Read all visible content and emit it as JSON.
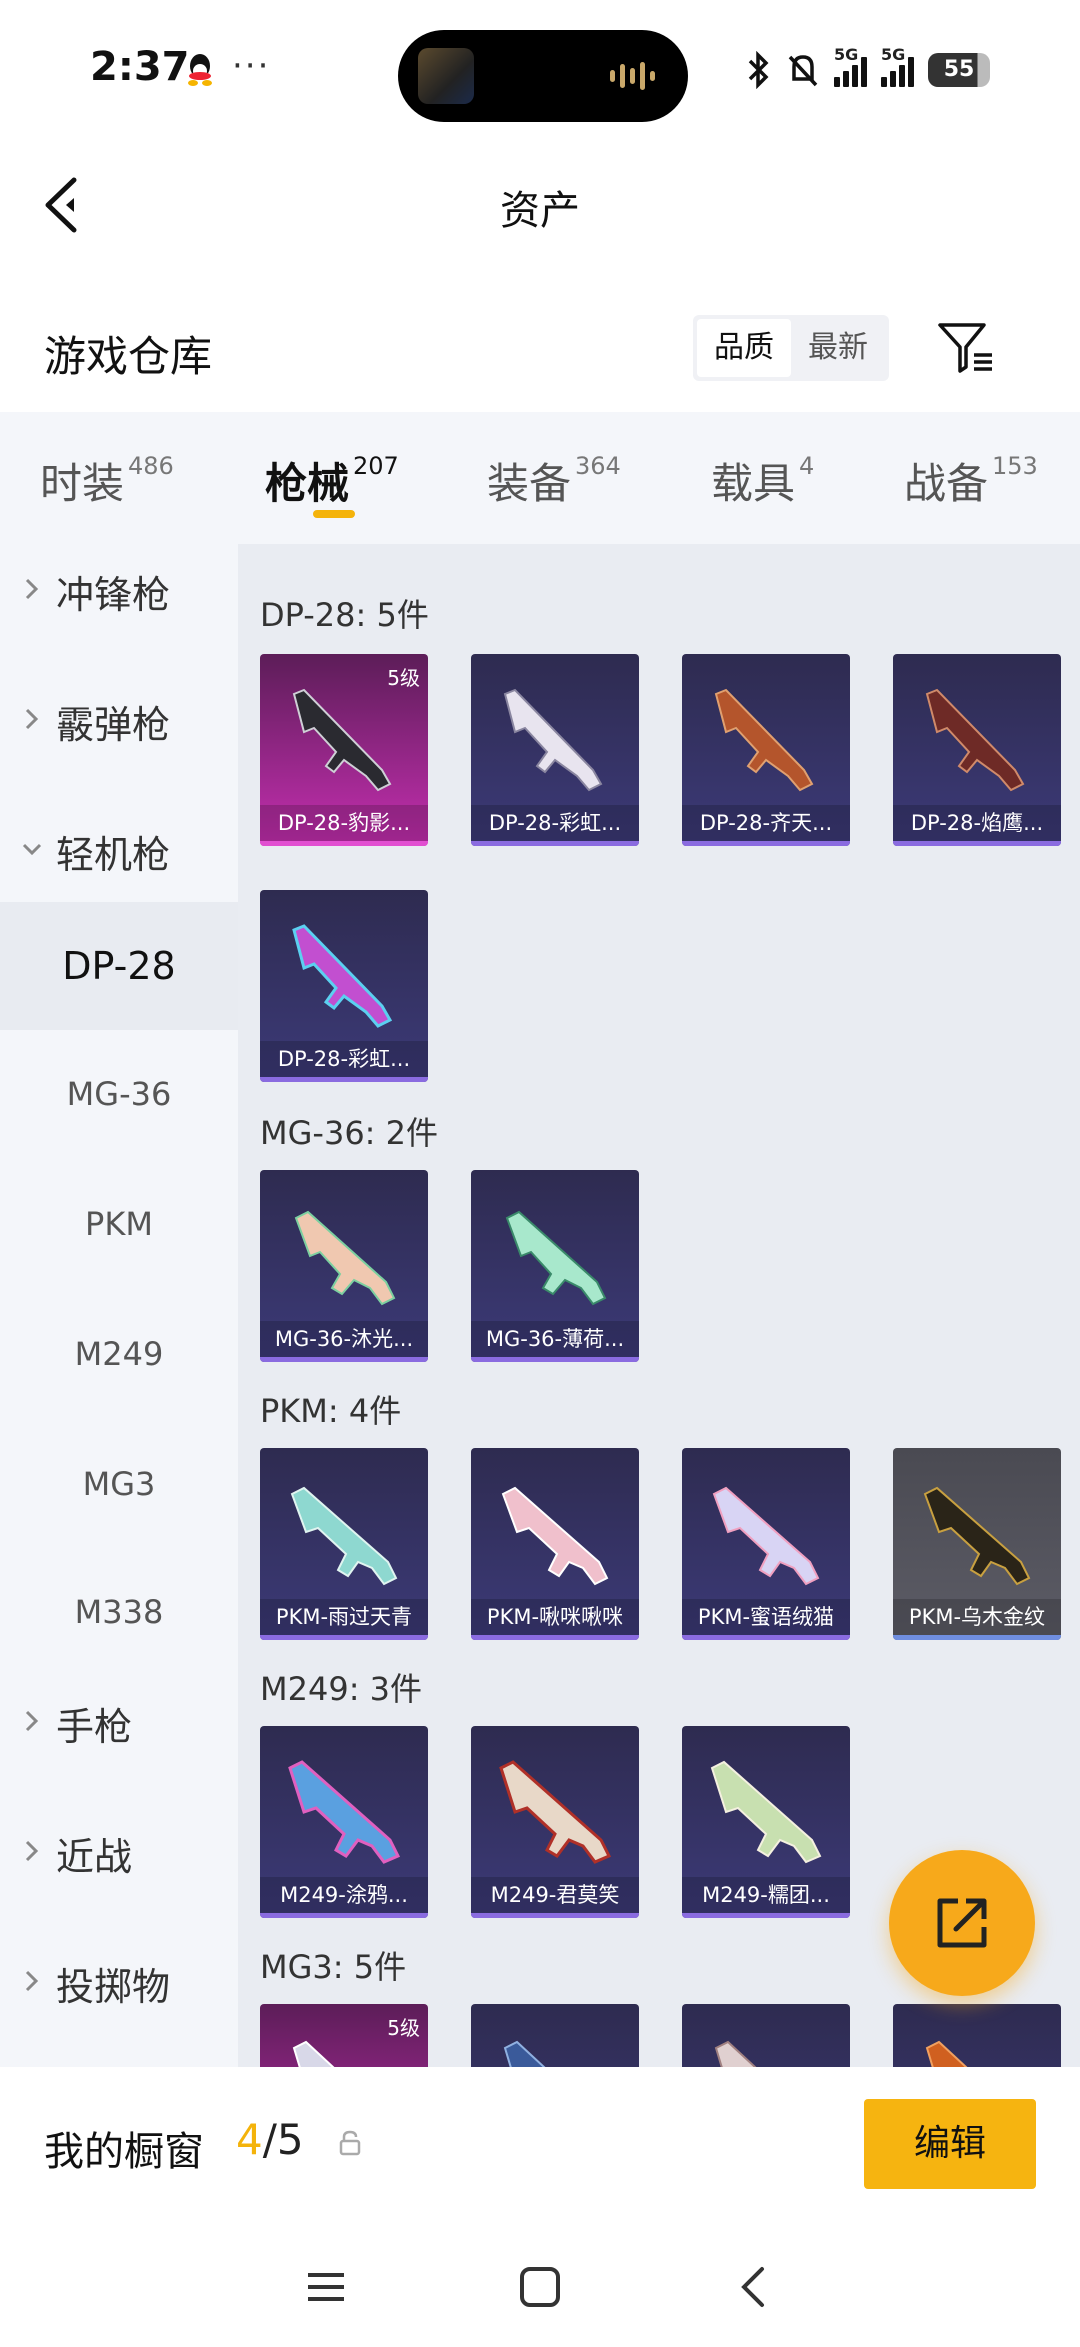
{
  "status_bar": {
    "time": "2:37",
    "dots": "···",
    "battery": "55",
    "signal_label": "5G"
  },
  "header": {
    "title": "资产"
  },
  "warehouse": {
    "title": "游戏仓库",
    "sort_options": [
      "品质",
      "最新"
    ],
    "active_sort": "品质"
  },
  "tabs": [
    {
      "label": "时装",
      "count": "486"
    },
    {
      "label": "枪械",
      "count": "207",
      "active": true
    },
    {
      "label": "装备",
      "count": "364"
    },
    {
      "label": "载具",
      "count": "4"
    },
    {
      "label": "战备",
      "count": "153"
    }
  ],
  "sidebar": {
    "categories": [
      {
        "label": "冲锋枪"
      },
      {
        "label": "霰弹枪"
      },
      {
        "label": "轻机枪",
        "expanded": true
      },
      {
        "label": "手枪"
      },
      {
        "label": "近战"
      },
      {
        "label": "投掷物"
      }
    ],
    "subitems": [
      {
        "label": "DP-28",
        "active": true
      },
      {
        "label": "MG-36"
      },
      {
        "label": "PKM"
      },
      {
        "label": "M249"
      },
      {
        "label": "MG3"
      },
      {
        "label": "M338"
      }
    ]
  },
  "groups": [
    {
      "title": "DP-28: 5件",
      "items": [
        {
          "name": "DP-28-豹影...",
          "level": "5级",
          "rarity": "purple"
        },
        {
          "name": "DP-28-彩虹...",
          "rarity": "blue"
        },
        {
          "name": "DP-28-齐天...",
          "rarity": "blue"
        },
        {
          "name": "DP-28-焰鹰...",
          "rarity": "blue"
        },
        {
          "name": "DP-28-彩虹...",
          "rarity": "blue"
        }
      ]
    },
    {
      "title": "MG-36: 2件",
      "items": [
        {
          "name": "MG-36-沐光...",
          "rarity": "blue"
        },
        {
          "name": "MG-36-薄荷...",
          "rarity": "blue"
        }
      ]
    },
    {
      "title": "PKM: 4件",
      "items": [
        {
          "name": "PKM-雨过天青",
          "rarity": "blue"
        },
        {
          "name": "PKM-啾咪啾咪",
          "rarity": "blue"
        },
        {
          "name": "PKM-蜜语绒猫",
          "rarity": "blue"
        },
        {
          "name": "PKM-乌木金纹",
          "rarity": "grey"
        }
      ]
    },
    {
      "title": "M249: 3件",
      "items": [
        {
          "name": "M249-涂鸦...",
          "rarity": "blue"
        },
        {
          "name": "M249-君莫笑",
          "rarity": "blue"
        },
        {
          "name": "M249-糯团...",
          "rarity": "blue"
        }
      ]
    },
    {
      "title": "MG3: 5件",
      "items": [
        {
          "name": "",
          "level": "5级",
          "rarity": "purple"
        },
        {
          "name": "",
          "rarity": "blue"
        },
        {
          "name": "",
          "rarity": "blue"
        },
        {
          "name": "",
          "rarity": "blue"
        }
      ]
    }
  ],
  "showcase": {
    "label": "我的橱窗",
    "current": "4",
    "total": "/5",
    "edit_label": "编辑"
  },
  "colors": {
    "accent": "#f6b410",
    "card_purple": "#c52fb0",
    "card_blue": "#3c3a78"
  },
  "icons": [
    "back-arrow-icon",
    "filter-icon",
    "share-icon",
    "lock-icon",
    "menu-icon",
    "home-icon",
    "back-icon"
  ]
}
